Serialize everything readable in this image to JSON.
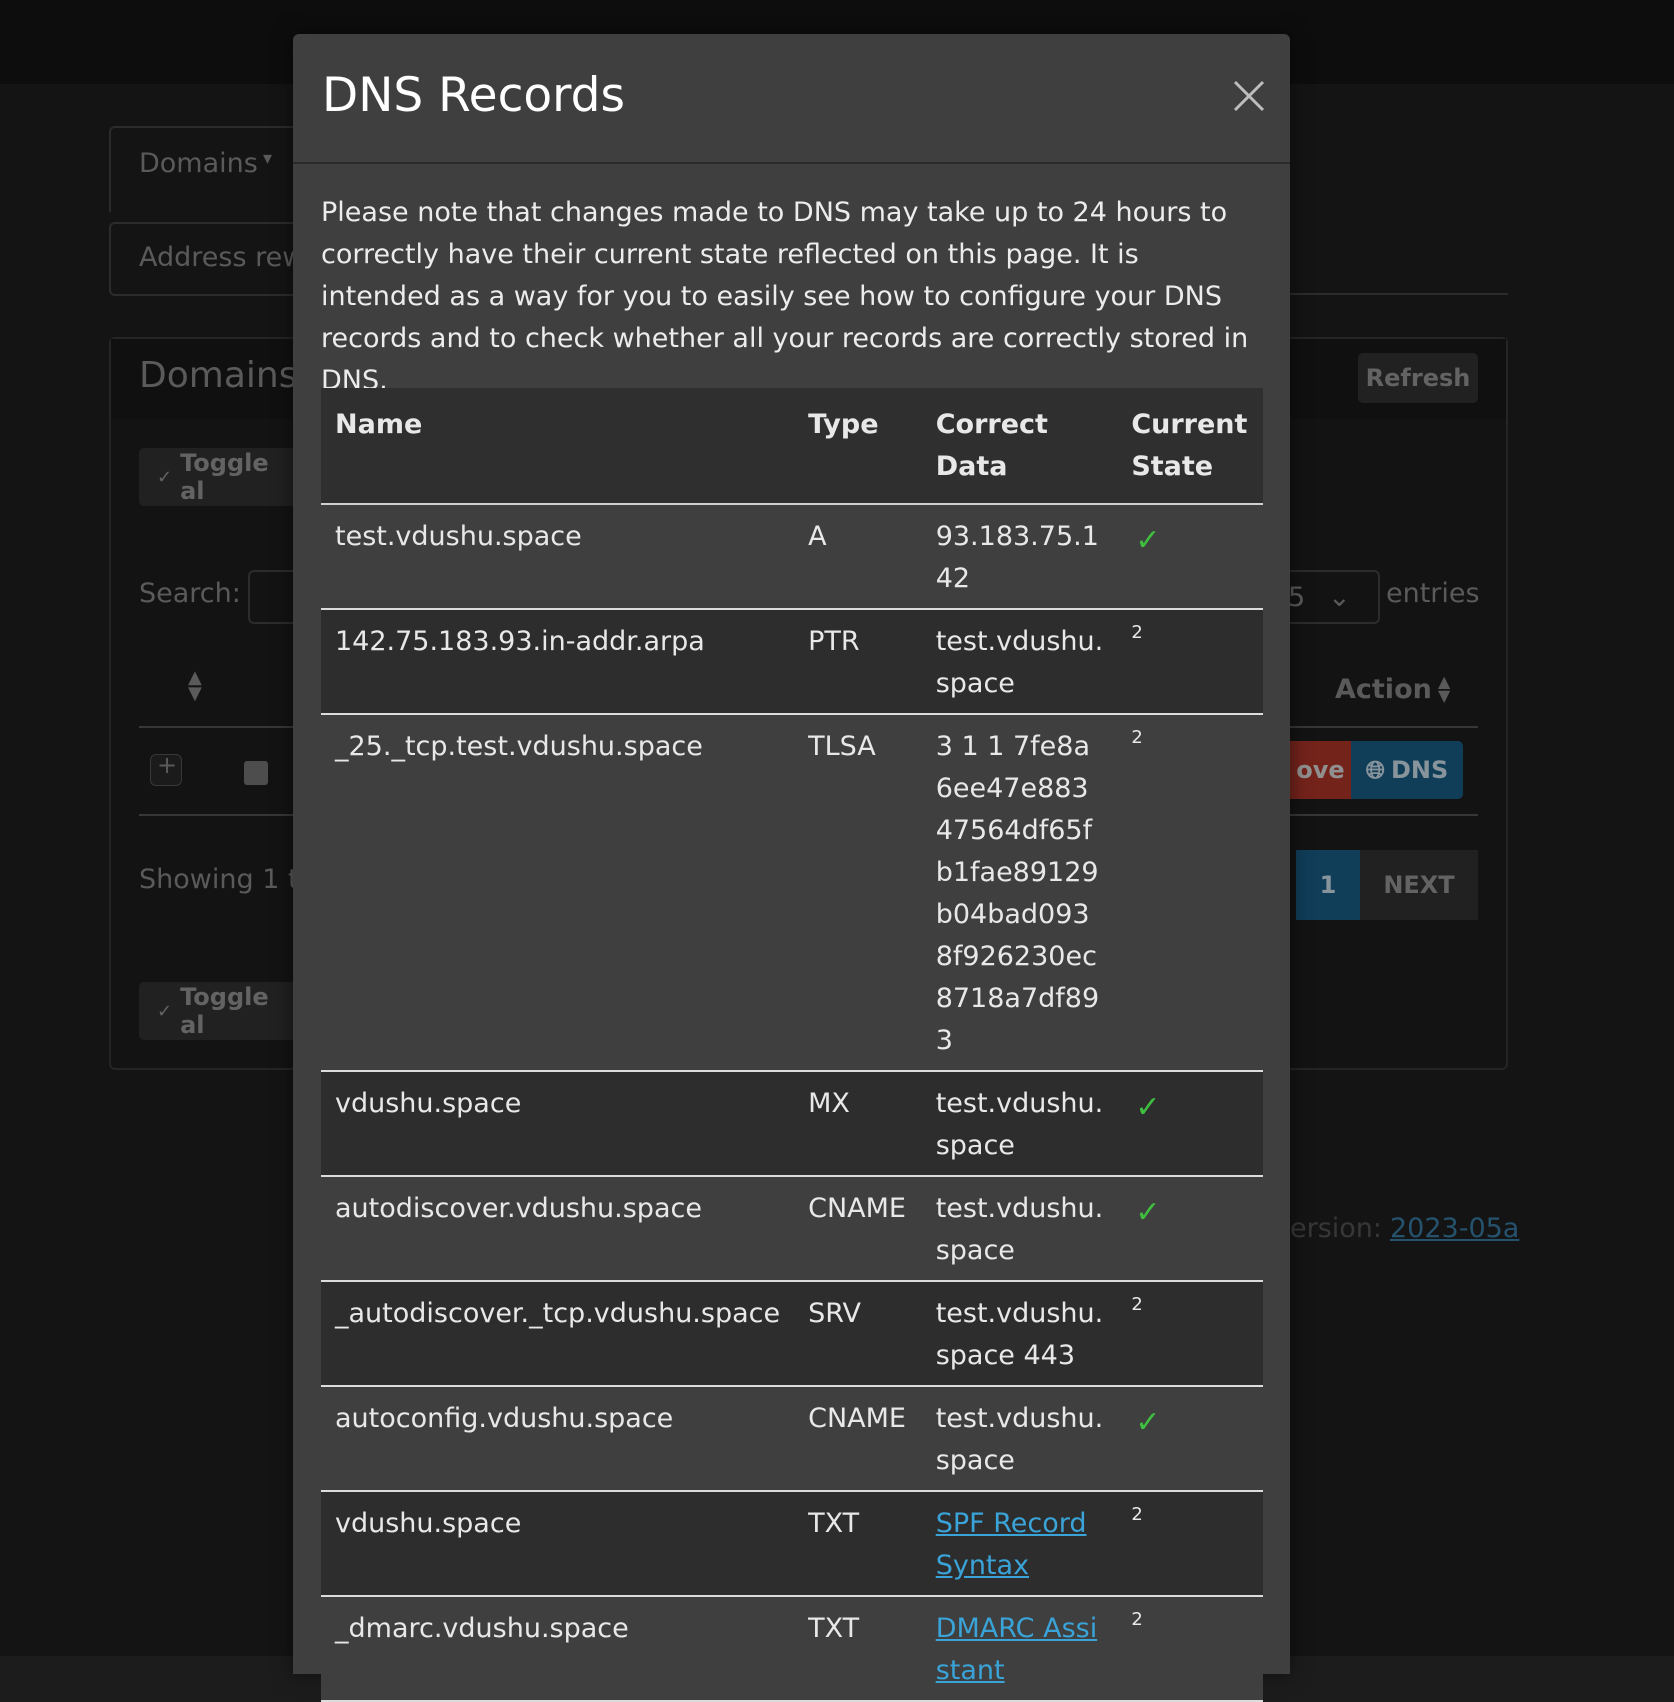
{
  "background": {
    "nav_dropdown_label": "Domains",
    "nav_item_2": "Address rew",
    "panel_title": "Domains",
    "refresh_label": "Refresh",
    "toggle_all_label": "Toggle al",
    "search_label": "Search:",
    "entries_value": "5",
    "entries_label": "entries",
    "action_header": "Action",
    "remove_label": "ove",
    "dns_label": "DNS",
    "showing_text": "Showing 1 t",
    "page_number": "1",
    "next_label": "NEXT",
    "version_label": "ersion:",
    "version_link": "2023-05a"
  },
  "modal": {
    "title": "DNS Records",
    "note": "Please note that changes made to DNS may take up to 24 hours to correctly have their current state reflected on this page. It is intended as a way for you to easily see how to configure your DNS records and to check whether all your records are correctly stored in DNS.",
    "columns": [
      "Name",
      "Type",
      "Correct Data",
      "Current State"
    ],
    "rows": [
      {
        "name": "test.vdushu.space",
        "type": "A",
        "data": "93.183.75.142",
        "state": "check"
      },
      {
        "name": "142.75.183.93.in-addr.arpa",
        "type": "PTR",
        "data": "test.vdushu.space",
        "state": "2"
      },
      {
        "name": "_25._tcp.test.vdushu.space",
        "type": "TLSA",
        "data": "3 1 1 7fe8a6ee47e88347564df65fb1fae89129b04bad0938f926230ec8718a7df893",
        "state": "2"
      },
      {
        "name": "vdushu.space",
        "type": "MX",
        "data": "test.vdushu.space",
        "state": "check"
      },
      {
        "name": "autodiscover.vdushu.space",
        "type": "CNAME",
        "data": "test.vdushu.space",
        "state": "check"
      },
      {
        "name": "_autodiscover._tcp.vdushu.space",
        "type": "SRV",
        "data": "test.vdushu.space 443",
        "state": "2"
      },
      {
        "name": "autoconfig.vdushu.space",
        "type": "CNAME",
        "data": "test.vdushu.space",
        "state": "check"
      },
      {
        "name": "vdushu.space",
        "type": "TXT",
        "data": "SPF Record Syntax",
        "data_is_link": true,
        "state": "2"
      },
      {
        "name": "_dmarc.vdushu.space",
        "type": "TXT",
        "data": "DMARC Assistant",
        "data_is_link": true,
        "state": "2"
      }
    ]
  },
  "colors": {
    "check": "#3fbf3f",
    "link": "#3aa3d8",
    "dns_button": "#1a5f88",
    "remove_button": "#c0392b",
    "page_active": "#1a5f88"
  }
}
